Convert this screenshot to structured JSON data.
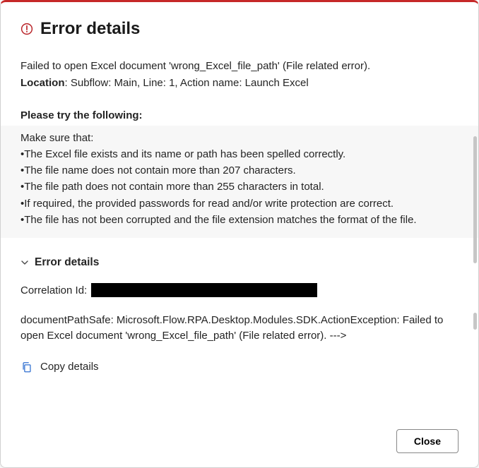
{
  "header": {
    "title": "Error details"
  },
  "error": {
    "message": "Failed to open Excel document 'wrong_Excel_file_path' (File related error).",
    "location_label": "Location",
    "location_value": "Subflow: Main, Line: 1, Action name: Launch Excel"
  },
  "suggestions": {
    "heading": "Please try the following:",
    "lead": "Make sure that:",
    "items": [
      "The Excel file exists and its name or path has been spelled correctly.",
      "The file name does not contain more than 207 characters.",
      "The file path does not contain more than 255 characters in total.",
      "If required, the provided passwords for read and/or write protection are correct.",
      "The file has not been corrupted and the file extension matches the format of the file."
    ]
  },
  "details": {
    "toggle_label": "Error details",
    "correlation_label": "Correlation Id:",
    "stack": "documentPathSafe: Microsoft.Flow.RPA.Desktop.Modules.SDK.ActionException: Failed to open Excel document 'wrong_Excel_file_path' (File related error). --->"
  },
  "actions": {
    "copy_label": "Copy details",
    "close_label": "Close"
  }
}
